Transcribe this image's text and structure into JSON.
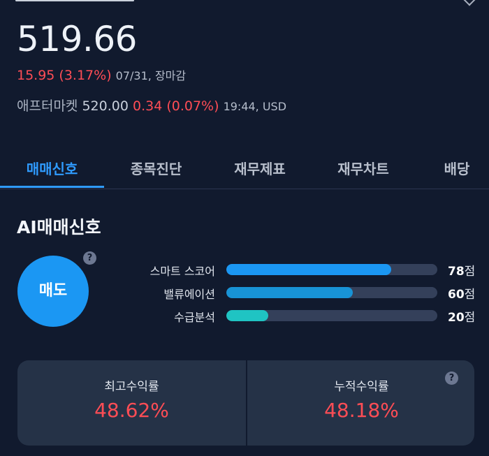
{
  "quote": {
    "price": "519.66",
    "change": "15.95 (3.17%)",
    "date_status": "07/31, 장마감",
    "after_label": "애프터마켓",
    "after_price": "520.00",
    "after_change": "0.34 (0.07%)",
    "after_time_currency": "19:44, USD"
  },
  "tabs": [
    "매매신호",
    "종목진단",
    "재무제표",
    "재무차트",
    "배당"
  ],
  "active_tab": "매매신호",
  "ai_signal": {
    "title": "AI매매신호",
    "help_icon": "?",
    "signal_label": "매도",
    "metrics": [
      {
        "label": "스마트 스코어",
        "score": 78,
        "unit": "점",
        "color": "#1b97f3"
      },
      {
        "label": "밸류에이션",
        "score": 60,
        "unit": "점",
        "color": "#1893d6"
      },
      {
        "label": "수급분석",
        "score": 20,
        "unit": "점",
        "color": "#1fc4c3"
      }
    ]
  },
  "returns": {
    "max_label": "최고수익률",
    "max_value": "48.62%",
    "cum_label": "누적수익률",
    "cum_value": "48.18%",
    "help_icon": "?"
  },
  "colors": {
    "background": "#111a2e",
    "accent": "#2f9bff",
    "up": "#ff4d55",
    "card": "#253247"
  }
}
